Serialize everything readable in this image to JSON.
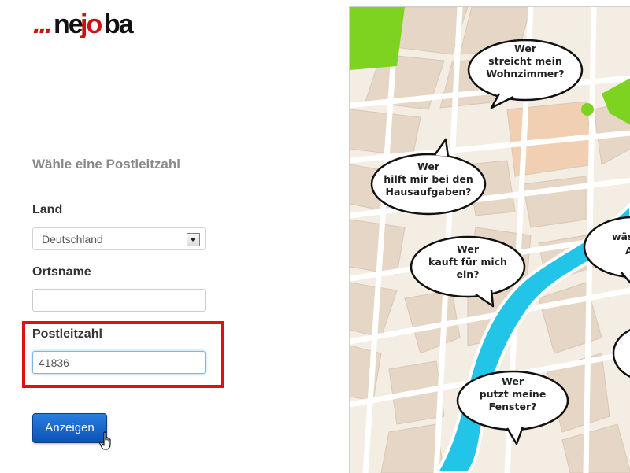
{
  "logo": {
    "dots": "...",
    "part1": "ne",
    "part2": "jo",
    "part3": "ba"
  },
  "form": {
    "heading": "Wähle eine Postleitzahl",
    "country_label": "Land",
    "country_value": "Deutschland",
    "city_label": "Ortsname",
    "city_value": "",
    "zip_label": "Postleitzahl",
    "zip_value": "41836",
    "submit_label": "Anzeigen"
  },
  "map": {
    "bubbles": [
      {
        "lines": [
          "Wer",
          "streicht mein",
          "Wohnzimmer?"
        ]
      },
      {
        "lines": [
          "Wer",
          "hilft mir bei den",
          "Hausaufgaben?"
        ]
      },
      {
        "lines": [
          "Wer",
          "kauft für mich",
          "ein?"
        ]
      },
      {
        "lines": [
          "Wer",
          "putzt meine",
          "Fenster?"
        ]
      },
      {
        "lines": [
          "wäs",
          "A"
        ]
      }
    ]
  },
  "colors": {
    "accent_red": "#e01010",
    "button_blue": "#0a52b5",
    "river": "#22c4e8",
    "park": "#7ed321",
    "map_bg": "#f3ede4",
    "block": "#e8d8c8"
  }
}
